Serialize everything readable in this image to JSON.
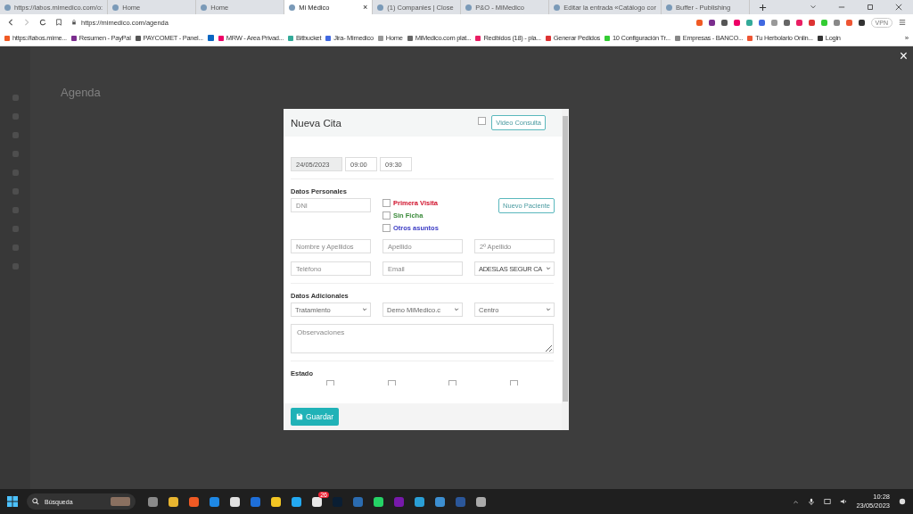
{
  "browser": {
    "tabs": [
      {
        "title": "https://labos.mimedico.com/o:",
        "selected": false
      },
      {
        "title": "Home",
        "selected": false
      },
      {
        "title": "Home",
        "selected": false
      },
      {
        "title": "Mi Médico",
        "selected": true
      },
      {
        "title": "(1) Companies | Close",
        "selected": false
      },
      {
        "title": "P&O - MiMedico",
        "selected": false
      },
      {
        "title": "Editar la entrada «Catálogo cor",
        "selected": false
      },
      {
        "title": "Buffer - Publishing",
        "selected": false
      }
    ],
    "tab_close": "×",
    "url": "https://mimedico.com/agenda",
    "vpn": "VPN",
    "bookmarks": [
      {
        "label": "https://labos.mime..."
      },
      {
        "label": "Resumen - PayPal"
      },
      {
        "label": "PAYCOMET - Panel..."
      },
      {
        "label": "MRW - Area Privad..."
      },
      {
        "label": "Bitbucket"
      },
      {
        "label": "Jira- Mimedico"
      },
      {
        "label": "Home"
      },
      {
        "label": "MiMedico.com plat..."
      },
      {
        "label": "Recibidos (18) - pla..."
      },
      {
        "label": "Generar Pedidos"
      },
      {
        "label": "10 Configuración Tr..."
      },
      {
        "label": "Empresas - BANCO..."
      },
      {
        "label": "Tu Herbolario Onlin..."
      },
      {
        "label": "Login"
      }
    ],
    "bookmarks_more": "»"
  },
  "page": {
    "heading": "Agenda",
    "overlay_close": "×"
  },
  "modal": {
    "title": "Nueva Cita",
    "video_consulta": {
      "label": "Video Consulta",
      "checked": false
    },
    "date": "24/05/2023",
    "start_time": "09:00",
    "end_time": "09:30",
    "personal_title": "Datos Personales",
    "dni_placeholder": "DNI",
    "flags": [
      {
        "label": "Primera Visita",
        "checked": false,
        "color": "#d0112b"
      },
      {
        "label": "Sin Ficha",
        "checked": false,
        "color": "#3a8a3a"
      },
      {
        "label": "Otros asuntos",
        "checked": false,
        "color": "#3b3bc4"
      }
    ],
    "new_patient_button": "Nuevo Paciente",
    "name_placeholder": "Nombre y Apellidos",
    "surname_placeholder": "Apellido",
    "surname2_placeholder": "2º Apellido",
    "phone_placeholder": "Teléfono",
    "email_placeholder": "Email",
    "insurer": "ADESLAS SEGUR CA",
    "additional_title": "Datos Adicionales",
    "selects": [
      "Tratamiento",
      "Demo MiMedico.c",
      "Centro"
    ],
    "notes_placeholder": "Observaciones",
    "status_title": "Estado",
    "status_options": [
      {
        "checked": false
      },
      {
        "checked": false
      },
      {
        "checked": false
      },
      {
        "checked": false
      }
    ],
    "save_button": "Guardar"
  },
  "taskbar": {
    "search_placeholder": "Búsqueda",
    "badge": "26",
    "time": "10:28",
    "date": "23/05/2023"
  }
}
